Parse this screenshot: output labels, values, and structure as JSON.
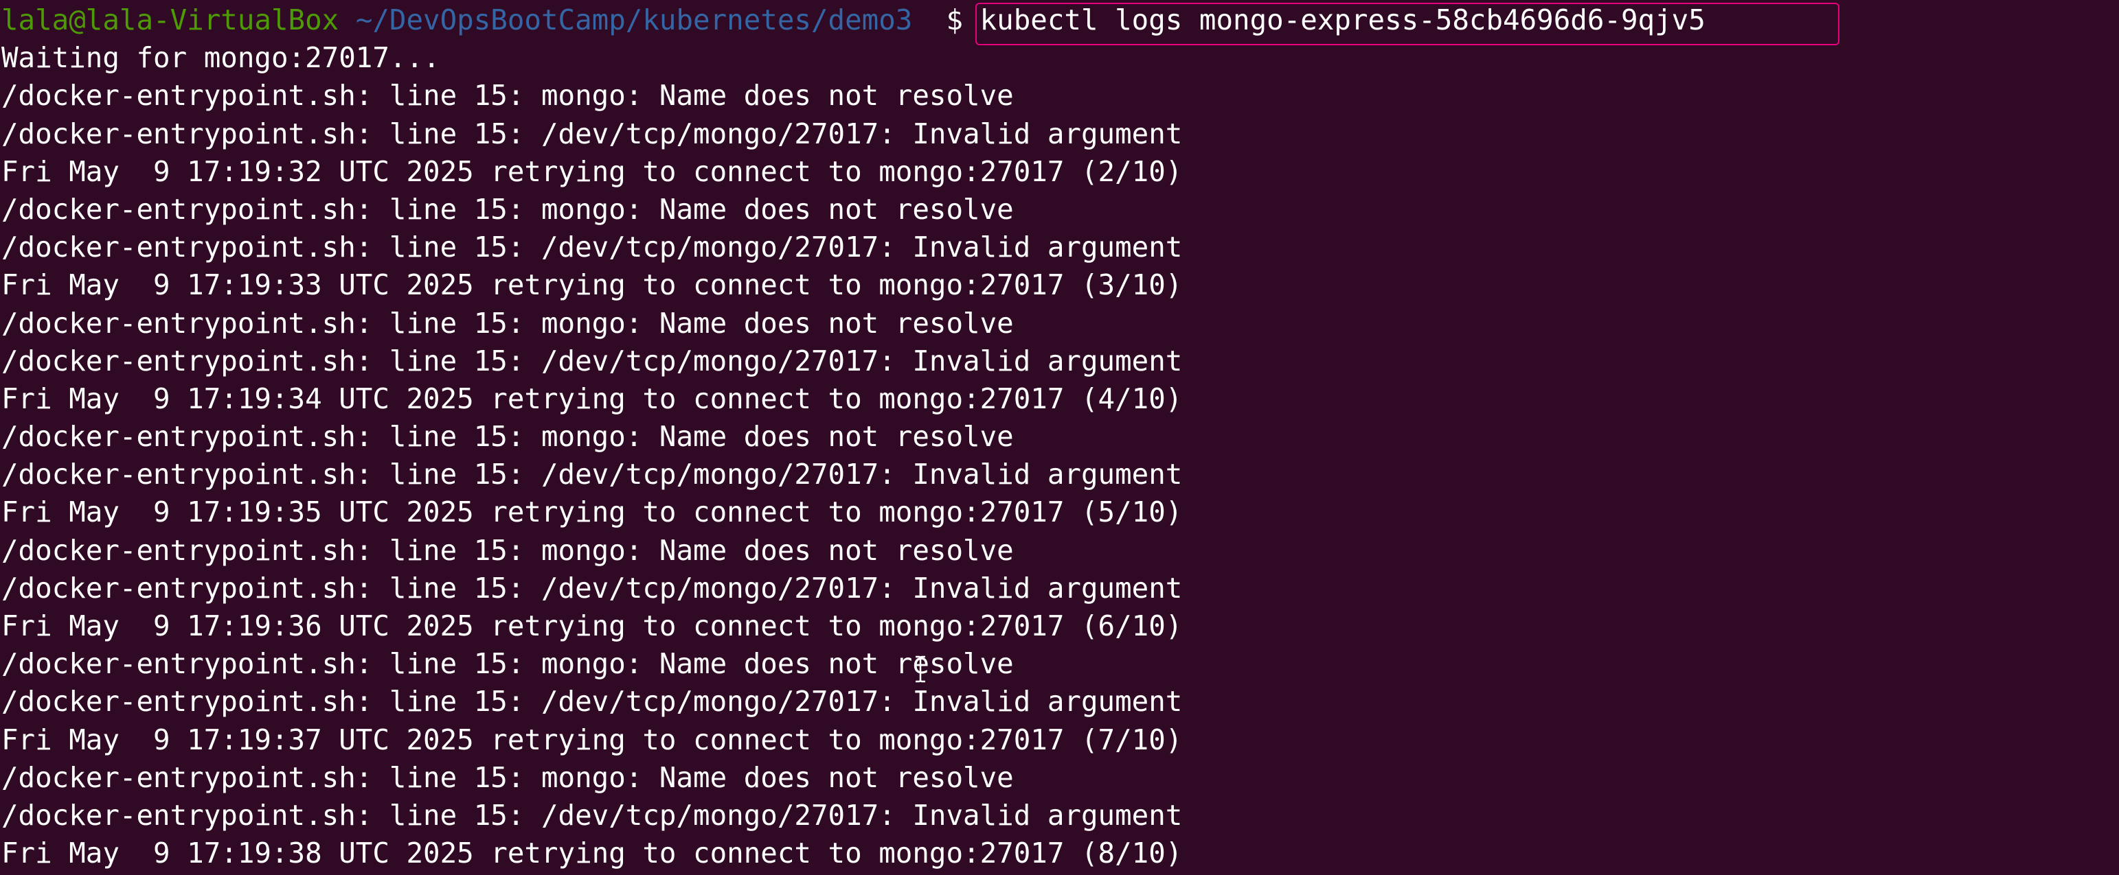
{
  "terminal": {
    "prompt": {
      "user_host": "lala@lala-VirtualBox",
      "path": "~/DevOpsBootCamp/kubernetes/demo3",
      "symbol": "$",
      "command": "kubectl logs mongo-express-58cb4696d6-9qjv5"
    },
    "output": [
      "Waiting for mongo:27017...",
      "/docker-entrypoint.sh: line 15: mongo: Name does not resolve",
      "/docker-entrypoint.sh: line 15: /dev/tcp/mongo/27017: Invalid argument",
      "Fri May  9 17:19:32 UTC 2025 retrying to connect to mongo:27017 (2/10)",
      "/docker-entrypoint.sh: line 15: mongo: Name does not resolve",
      "/docker-entrypoint.sh: line 15: /dev/tcp/mongo/27017: Invalid argument",
      "Fri May  9 17:19:33 UTC 2025 retrying to connect to mongo:27017 (3/10)",
      "/docker-entrypoint.sh: line 15: mongo: Name does not resolve",
      "/docker-entrypoint.sh: line 15: /dev/tcp/mongo/27017: Invalid argument",
      "Fri May  9 17:19:34 UTC 2025 retrying to connect to mongo:27017 (4/10)",
      "/docker-entrypoint.sh: line 15: mongo: Name does not resolve",
      "/docker-entrypoint.sh: line 15: /dev/tcp/mongo/27017: Invalid argument",
      "Fri May  9 17:19:35 UTC 2025 retrying to connect to mongo:27017 (5/10)",
      "/docker-entrypoint.sh: line 15: mongo: Name does not resolve",
      "/docker-entrypoint.sh: line 15: /dev/tcp/mongo/27017: Invalid argument",
      "Fri May  9 17:19:36 UTC 2025 retrying to connect to mongo:27017 (6/10)",
      "/docker-entrypoint.sh: line 15: mongo: Name does not resolve",
      "/docker-entrypoint.sh: line 15: /dev/tcp/mongo/27017: Invalid argument",
      "Fri May  9 17:19:37 UTC 2025 retrying to connect to mongo:27017 (7/10)",
      "/docker-entrypoint.sh: line 15: mongo: Name does not resolve",
      "/docker-entrypoint.sh: line 15: /dev/tcp/mongo/27017: Invalid argument",
      "Fri May  9 17:19:38 UTC 2025 retrying to connect to mongo:27017 (8/10)"
    ]
  },
  "colors": {
    "background": "#300a24",
    "prompt_user": "#4e9a06",
    "prompt_path": "#3465a4",
    "text": "#ffffff",
    "highlight_box": "#e6007e"
  },
  "icons": {
    "mouse_cursor": "text-cursor-icon"
  }
}
